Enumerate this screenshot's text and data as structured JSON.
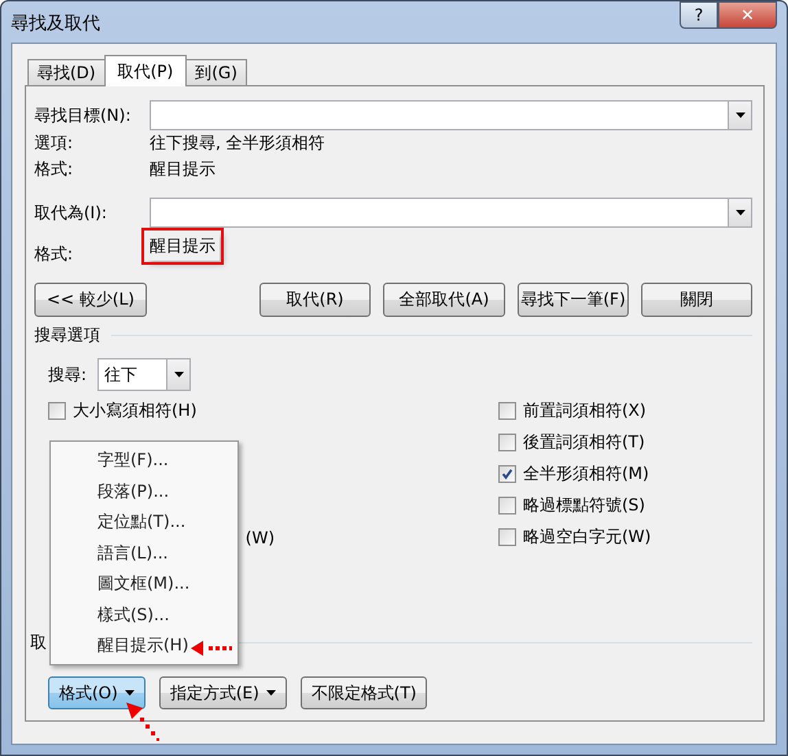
{
  "window": {
    "title": "尋找及取代",
    "buttons": [
      "?",
      "✕"
    ]
  },
  "tabs": [
    {
      "label": "尋找(D)",
      "selected": false
    },
    {
      "label": "取代(P)",
      "selected": true
    },
    {
      "label": "到(G)",
      "selected": false
    }
  ],
  "find": {
    "label": "尋找目標(N):"
  },
  "find_info": [
    {
      "label": "選項:",
      "value": "往下搜尋, 全半形須相符"
    },
    {
      "label": "格式:",
      "value": "醒目提示"
    }
  ],
  "replace": {
    "label": "取代為(I):"
  },
  "replace_format": {
    "label": "格式:",
    "value": "醒目提示",
    "highlighted": true
  },
  "less_button": "<< 較少(L)",
  "action_buttons": [
    "取代(R)",
    "全部取代(A)",
    "尋找下一筆(F)",
    "關閉"
  ],
  "search_options": {
    "title": "搜尋選項",
    "direction_label": "搜尋:",
    "direction_value": "往下",
    "left": [
      {
        "label": "大小寫須相符(H)",
        "checked": false
      }
    ],
    "left_fragment": "(W)",
    "right": [
      {
        "label": "前置詞須相符(X)",
        "checked": false
      },
      {
        "label": "後置詞須相符(T)",
        "checked": false
      },
      {
        "label": "全半形須相符(M)",
        "checked": true
      },
      {
        "label": "略過標點符號(S)",
        "checked": false
      },
      {
        "label": "略過空白字元(W)",
        "checked": false
      }
    ]
  },
  "replace_section_label": "取",
  "bottom_buttons": [
    {
      "label": "格式(O)",
      "kind": "dropdown",
      "selected": true
    },
    {
      "label": "指定方式(E)",
      "kind": "dropdown",
      "selected": false
    },
    {
      "label": "不限定格式(T)",
      "kind": "plain",
      "selected": false
    }
  ],
  "menu": {
    "items": [
      "字型(F)...",
      "段落(P)...",
      "定位點(T)...",
      "語言(L)...",
      "圖文框(M)...",
      "樣式(S)...",
      "醒目提示(H)"
    ]
  }
}
